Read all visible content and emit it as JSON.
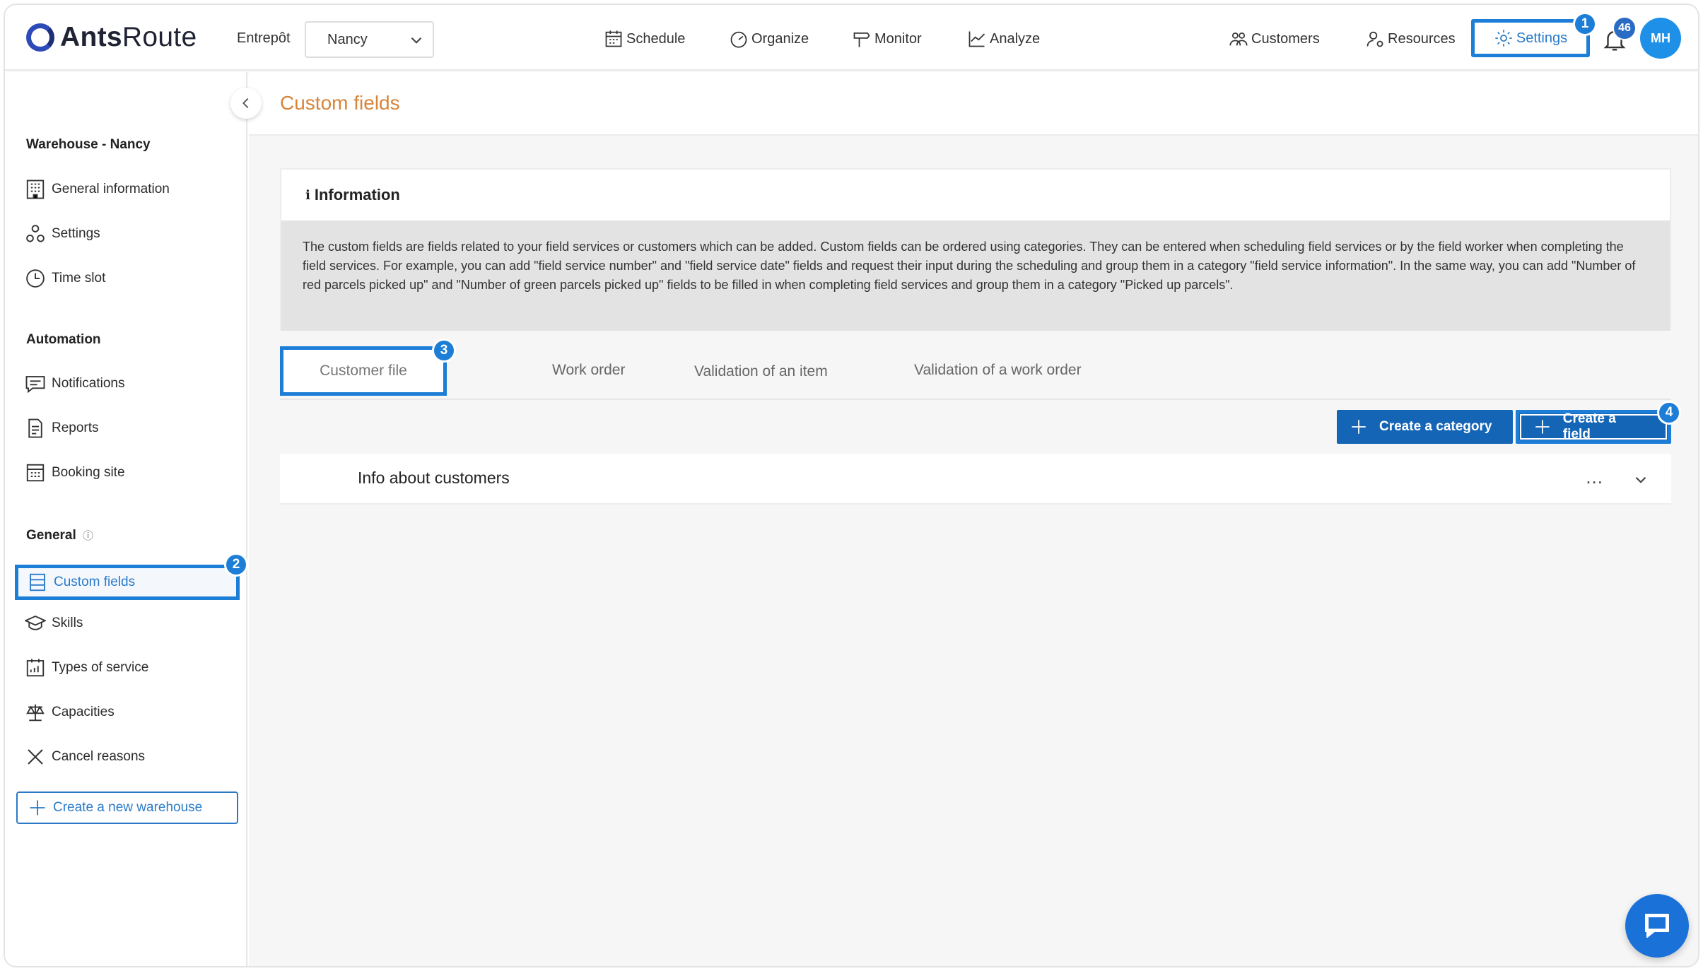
{
  "brand": {
    "name_bold": "Ants",
    "name_rest": "Route"
  },
  "header": {
    "warehouse_label": "Entrepôt",
    "warehouse_value": "Nancy",
    "nav": [
      {
        "label": "Schedule",
        "icon": "calendar-icon"
      },
      {
        "label": "Organize",
        "icon": "gauge-icon"
      },
      {
        "label": "Monitor",
        "icon": "signpost-icon"
      },
      {
        "label": "Analyze",
        "icon": "chart-icon"
      }
    ],
    "right_nav": [
      {
        "label": "Customers",
        "icon": "users-icon"
      },
      {
        "label": "Resources",
        "icon": "user-gear-icon"
      },
      {
        "label": "Settings",
        "icon": "gear-icon"
      }
    ],
    "notification_count": "46",
    "avatar_initials": "MH"
  },
  "steps": {
    "s1": "1",
    "s2": "2",
    "s3": "3",
    "s4": "4"
  },
  "sidebar": {
    "section_warehouse": "Warehouse - Nancy",
    "section_automation": "Automation",
    "section_general": "General",
    "items_warehouse": [
      {
        "label": "General information"
      },
      {
        "label": "Settings"
      },
      {
        "label": "Time slot"
      }
    ],
    "items_automation": [
      {
        "label": "Notifications"
      },
      {
        "label": "Reports"
      },
      {
        "label": "Booking site"
      }
    ],
    "items_general": [
      {
        "label": "Custom fields"
      },
      {
        "label": "Skills"
      },
      {
        "label": "Types of service"
      },
      {
        "label": "Capacities"
      },
      {
        "label": "Cancel reasons"
      }
    ],
    "new_warehouse": "Create a new warehouse"
  },
  "main": {
    "title": "Custom fields",
    "info_title": "Information",
    "info_text": "The custom fields are fields related to your field services or customers which can be added. Custom fields can be ordered using categories. They can be entered when scheduling field services or by the field worker when completing the field services. For example, you can add \"field service number\" and \"field service date\" fields and request their input during the scheduling and group them in a category \"field service information\". In the same way, you can add \"Number of red parcels picked up\" and \"Number of green parcels picked up\" fields to be filled in when completing field services and group them in a category \"Picked up parcels\".",
    "tabs": [
      {
        "label": "Customer file"
      },
      {
        "label": "Work order"
      },
      {
        "label": "Validation of an item"
      },
      {
        "label": "Validation of a work order"
      }
    ],
    "create_category": "Create a category",
    "create_field": "Create a field",
    "category_name": "Info about customers",
    "more_label": "..."
  }
}
